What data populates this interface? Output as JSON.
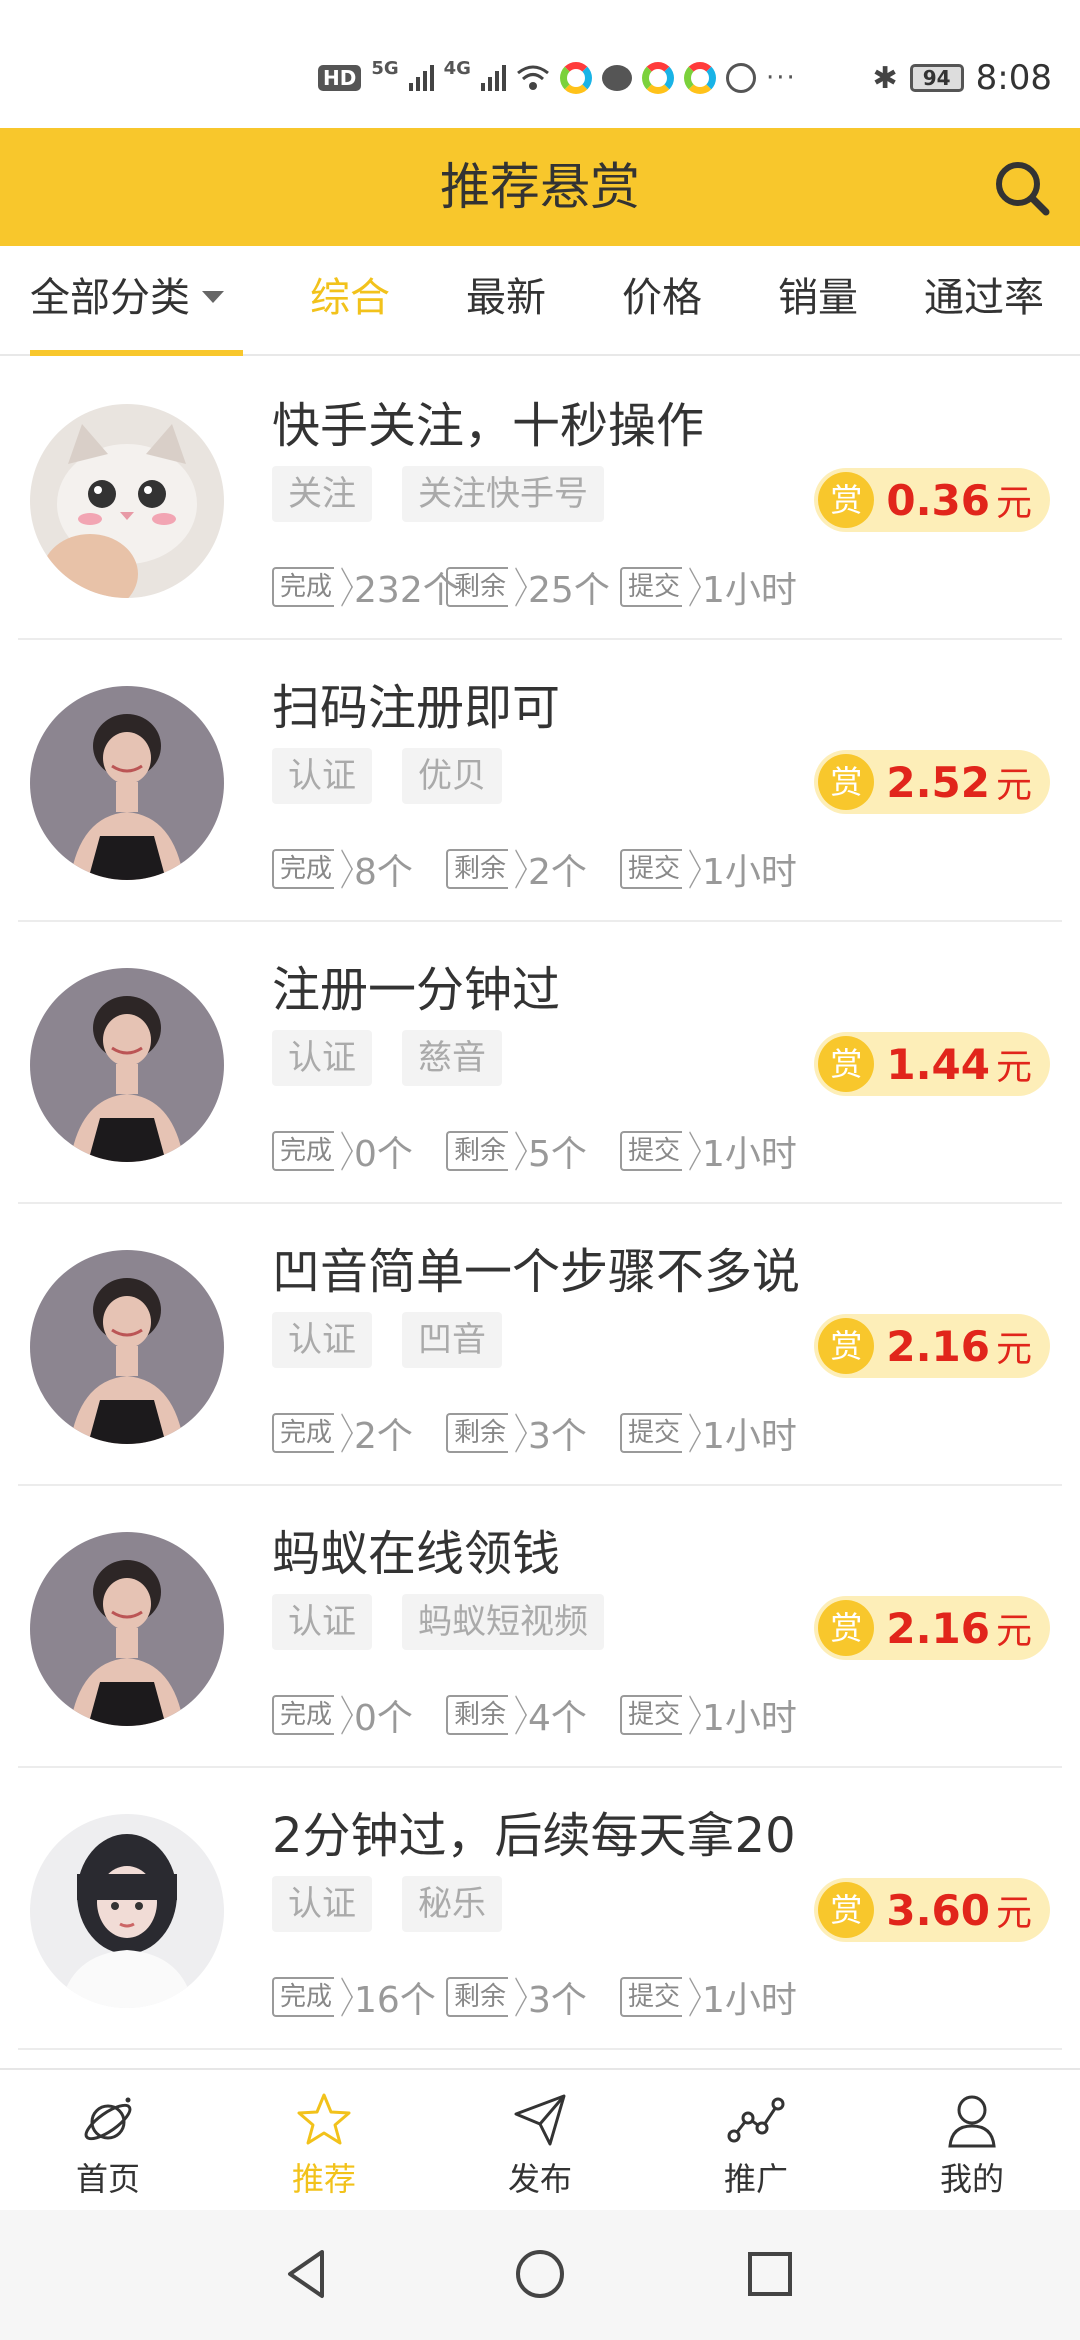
{
  "status_bar": {
    "hd_label": "HD",
    "net_5g": "5G",
    "net_4g": "4G",
    "more": "···",
    "battery": "94",
    "time": "8:08"
  },
  "header": {
    "title": "推荐悬赏"
  },
  "filter": {
    "category": "全部分类",
    "tabs": [
      "综合",
      "最新",
      "价格",
      "销量",
      "通过率"
    ],
    "active_tab": "综合"
  },
  "tasks": [
    {
      "title": "快手关注，十秒操作",
      "tags": [
        "关注",
        "关注快手号"
      ],
      "reward": "0.36",
      "unit": "元",
      "reward_badge": "赏",
      "done_label": "完成",
      "done": "232个",
      "left_label": "剩余",
      "left": "25个",
      "submit_label": "提交",
      "submit": "1小时",
      "avatar": "cat-avatar"
    },
    {
      "title": "扫码注册即可",
      "tags": [
        "认证",
        "优贝"
      ],
      "reward": "2.52",
      "unit": "元",
      "reward_badge": "赏",
      "done_label": "完成",
      "done": "8个",
      "left_label": "剩余",
      "left": "2个",
      "submit_label": "提交",
      "submit": "1小时",
      "avatar": "girl-avatar"
    },
    {
      "title": "注册一分钟过",
      "tags": [
        "认证",
        "慈音"
      ],
      "reward": "1.44",
      "unit": "元",
      "reward_badge": "赏",
      "done_label": "完成",
      "done": "0个",
      "left_label": "剩余",
      "left": "5个",
      "submit_label": "提交",
      "submit": "1小时",
      "avatar": "girl-avatar"
    },
    {
      "title": "凹音简单一个步骤不多说",
      "tags": [
        "认证",
        "凹音"
      ],
      "reward": "2.16",
      "unit": "元",
      "reward_badge": "赏",
      "done_label": "完成",
      "done": "2个",
      "left_label": "剩余",
      "left": "3个",
      "submit_label": "提交",
      "submit": "1小时",
      "avatar": "girl-avatar"
    },
    {
      "title": "蚂蚁在线领钱",
      "tags": [
        "认证",
        "蚂蚁短视频"
      ],
      "reward": "2.16",
      "unit": "元",
      "reward_badge": "赏",
      "done_label": "完成",
      "done": "0个",
      "left_label": "剩余",
      "left": "4个",
      "submit_label": "提交",
      "submit": "1小时",
      "avatar": "girl-avatar"
    },
    {
      "title": "2分钟过，后续每天拿20",
      "tags": [
        "认证",
        "秘乐"
      ],
      "reward": "3.60",
      "unit": "元",
      "reward_badge": "赏",
      "done_label": "完成",
      "done": "16个",
      "left_label": "剩余",
      "left": "3个",
      "submit_label": "提交",
      "submit": "1小时",
      "avatar": "girl2-avatar"
    }
  ],
  "bottom_nav": {
    "items": [
      {
        "label": "首页",
        "icon": "home-planet-icon"
      },
      {
        "label": "推荐",
        "icon": "star-icon"
      },
      {
        "label": "发布",
        "icon": "send-icon"
      },
      {
        "label": "推广",
        "icon": "share-graph-icon"
      },
      {
        "label": "我的",
        "icon": "user-icon"
      }
    ],
    "active": "推荐"
  },
  "system_nav": {
    "back": "back-triangle-icon",
    "home": "home-circle-icon",
    "recent": "recent-square-icon"
  },
  "colors": {
    "accent": "#f8c72c",
    "price": "#e1251b",
    "reward_bg": "#fdeeb8"
  }
}
